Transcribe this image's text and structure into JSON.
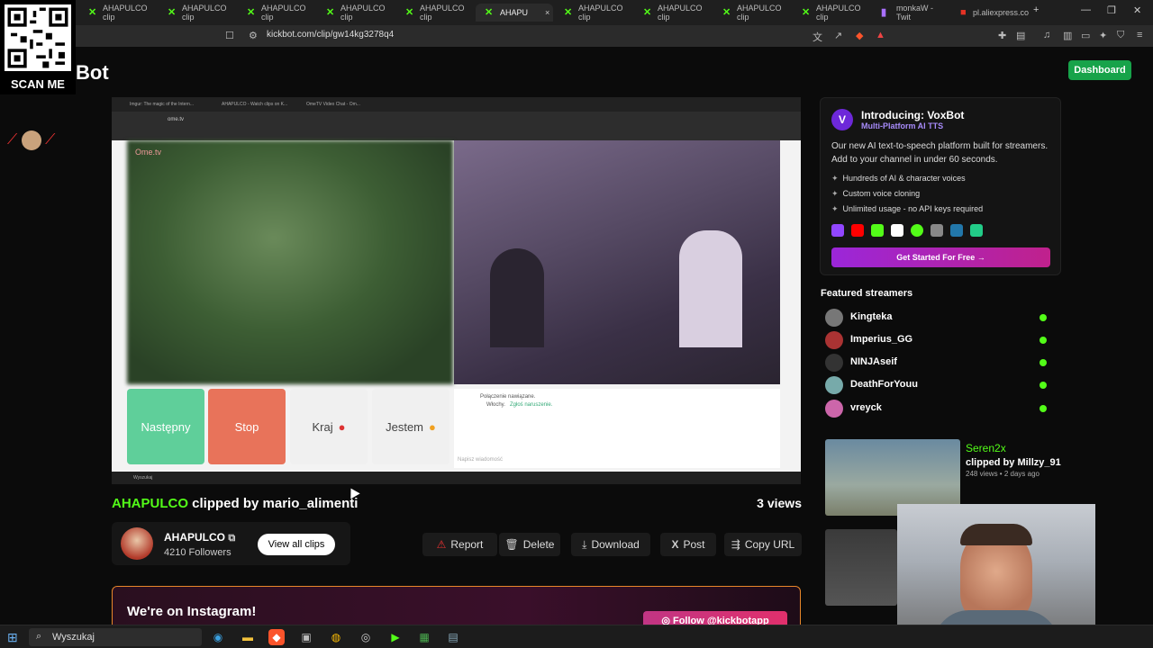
{
  "browser": {
    "tabs": [
      {
        "label": "AHAPULCO clip"
      },
      {
        "label": "AHAPULCO clip"
      },
      {
        "label": "AHAPULCO clip"
      },
      {
        "label": "AHAPULCO clip"
      },
      {
        "label": "AHAPULCO clip"
      },
      {
        "label": "AHAPU"
      },
      {
        "label": "AHAPULCO clip"
      },
      {
        "label": "AHAPULCO clip"
      },
      {
        "label": "AHAPULCO clip"
      },
      {
        "label": "AHAPULCO clip"
      },
      {
        "label": "monkaW - Twit"
      },
      {
        "label": "pl.aliexpress.co"
      }
    ],
    "url": "kickbot.com/clip/gw14kg3278q4"
  },
  "overlay": {
    "qr_label": "SCAN ME"
  },
  "header": {
    "logo_text": "Bot",
    "dashboard_label": "Dashboard"
  },
  "player": {
    "inner_tabs": [
      "Imgur: The magic of the Intern...",
      "AHAPULCO - Watch clips on K...",
      "OmeTV Video Chat - Om..."
    ],
    "inner_url": "ome.tv",
    "ome_logo": "Ome.tv",
    "buttons": {
      "next": "Następny",
      "stop": "Stop",
      "country": "Kraj",
      "gender": "Jestem"
    },
    "chat_status": "Połączenie nawiązane.",
    "chat_country": "Włochy.",
    "chat_report": "Zgłoś naruszenie.",
    "chat_placeholder": "Napisz wiadomość",
    "inner_search": "Wyszukaj"
  },
  "clip": {
    "channel": "AHAPULCO",
    "clipped_by_text": "clipped by mario_alimenti",
    "views": "3 views",
    "streamer_name": "AHAPULCO",
    "followers": "4210 Followers",
    "view_all_label": "View all clips"
  },
  "actions": {
    "report": "Report",
    "delete": "Delete",
    "download": "Download",
    "post": "Post",
    "copy_url": "Copy URL"
  },
  "instagram": {
    "text": "We're on Instagram!",
    "button": "Follow @kickbotapp"
  },
  "promo": {
    "title": "Introducing: VoxBot",
    "subtitle": "Multi-Platform AI TTS",
    "description": "Our new AI text-to-speech platform built for streamers. Add to your channel in under 60 seconds.",
    "features": [
      "Hundreds of AI & character voices",
      "Custom voice cloning",
      "Unlimited usage - no API keys required"
    ],
    "cta": "Get Started For Free →"
  },
  "featured": {
    "heading": "Featured streamers",
    "streamers": [
      {
        "name": "Kingteka"
      },
      {
        "name": "Imperius_GG"
      },
      {
        "name": "NINJAseif"
      },
      {
        "name": "DeathForYouu"
      },
      {
        "name": "vreyck"
      }
    ]
  },
  "related_clip": {
    "title": "Seren2x",
    "clipped_by": "clipped by Millzy_91",
    "meta": "248 views • 2 days ago"
  },
  "taskbar": {
    "search_placeholder": "Wyszukaj"
  },
  "colors": {
    "kick_green": "#53fc18",
    "dashboard_green": "#17a34a",
    "stop_red": "#e8735a",
    "next_green": "#5fcf9a"
  }
}
